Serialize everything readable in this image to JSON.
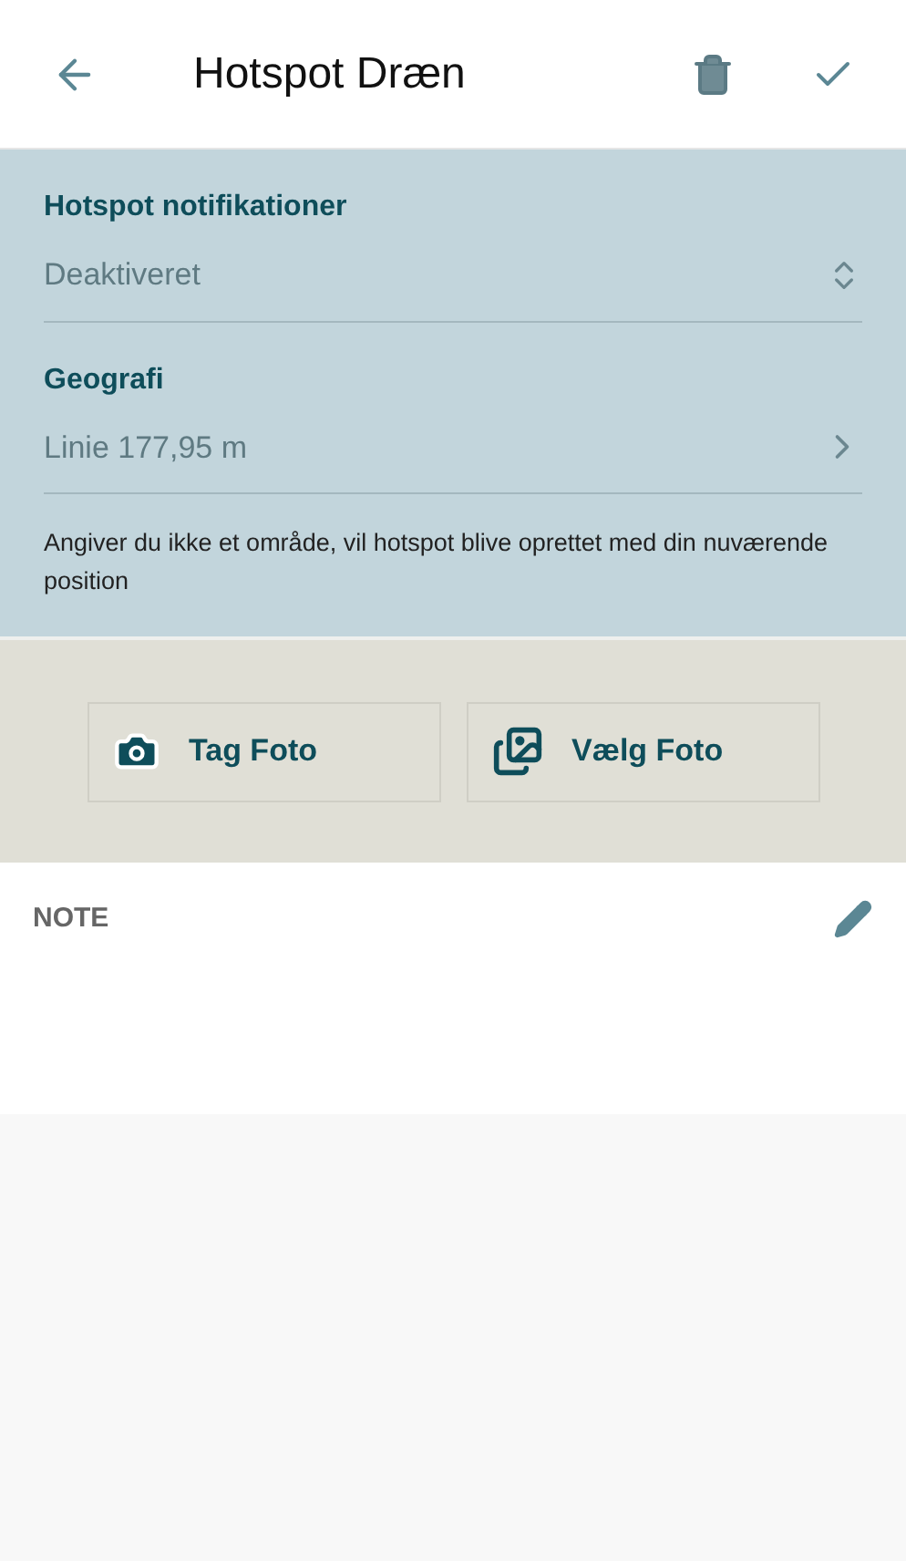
{
  "header": {
    "title": "Hotspot Dræn"
  },
  "fields": [
    {
      "kind": "select",
      "label": "Hotspot notifikationer",
      "value": "Deaktiveret"
    },
    {
      "kind": "link",
      "label": "Geografi",
      "value": "Linie 177,95 m"
    }
  ],
  "hint": "Angiver du ikke et område, vil hotspot blive oprettet med din nuværende position",
  "photo_buttons": [
    {
      "kind": "camera",
      "label": "Tag Foto"
    },
    {
      "kind": "gallery",
      "label": "Vælg Foto"
    }
  ],
  "note": {
    "label": "NOTE"
  }
}
